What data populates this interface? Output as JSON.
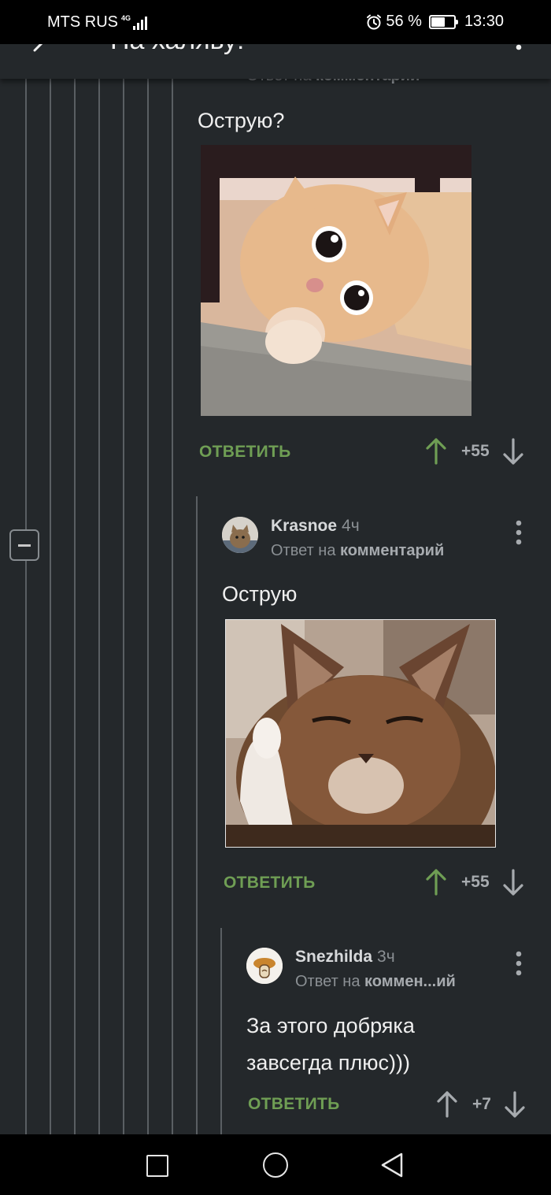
{
  "status_bar": {
    "carrier": "MTS RUS",
    "network": "4G",
    "battery_percent": "56 %",
    "time": "13:30"
  },
  "app_bar": {
    "title": "На халяву!"
  },
  "comments": [
    {
      "reply_prefix": "Ответ на",
      "reply_target": "комментарий",
      "text": "Острую?",
      "image_icon": "scared-cat-photo",
      "reply_label": "ОТВЕТИТЬ",
      "score": "+55",
      "voted_up": true
    },
    {
      "author": "Krasnoe",
      "time": "4ч",
      "reply_prefix": "Ответ на",
      "reply_target": "комментарий",
      "text": "Острую",
      "image_icon": "smug-cat-thumbs-up-photo",
      "reply_label": "ОТВЕТИТЬ",
      "score": "+55",
      "voted_up": true
    },
    {
      "author": "Snezhilda",
      "time": "3ч",
      "reply_prefix": "Ответ на",
      "reply_target": "коммен...ий",
      "text_lines": [
        "За этого добряка",
        "завсегда плюс)))"
      ],
      "reply_label": "ОТВЕТИТЬ",
      "score": "+7",
      "voted_up": false
    }
  ],
  "colors": {
    "background": "#24282b",
    "accent_green": "#6f9e54",
    "thread_line": "#5a5f63"
  }
}
